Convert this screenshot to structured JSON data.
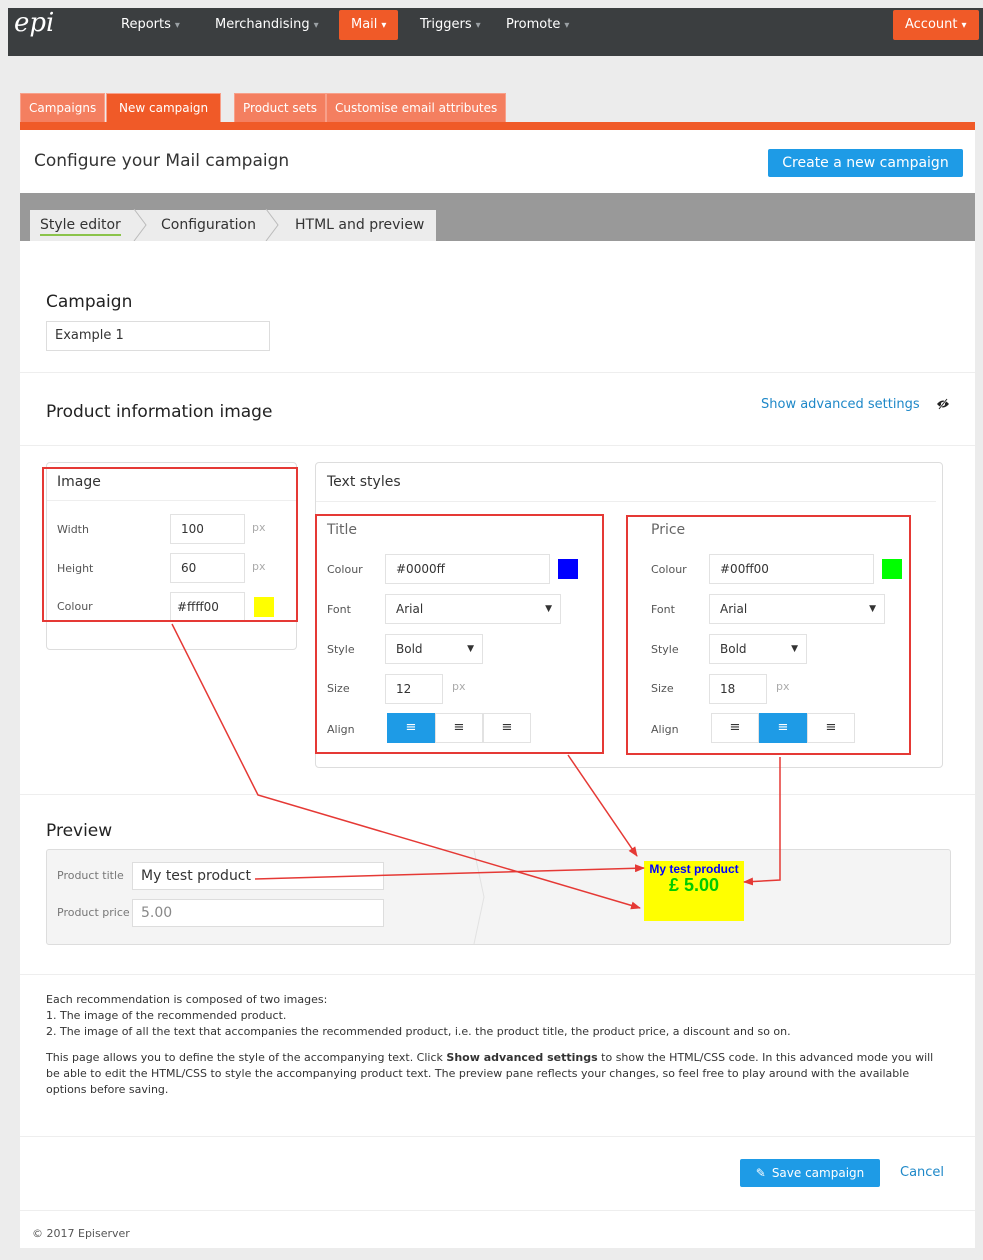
{
  "nav": {
    "logo": "epi",
    "items": [
      {
        "label": "Reports"
      },
      {
        "label": "Merchandising"
      },
      {
        "label": "Mail"
      },
      {
        "label": "Triggers"
      },
      {
        "label": "Promote"
      }
    ],
    "active": "Mail",
    "account": "Account"
  },
  "tabs": [
    {
      "label": "Campaigns"
    },
    {
      "label": "New campaign"
    },
    {
      "label": "Product sets"
    },
    {
      "label": "Customise email attributes"
    }
  ],
  "page": {
    "title": "Configure your Mail campaign",
    "create_button": "Create a new campaign"
  },
  "steps": [
    "Style editor",
    "Configuration",
    "HTML and preview"
  ],
  "campaign": {
    "heading": "Campaign",
    "name_value": "Example 1"
  },
  "product_info": {
    "heading": "Product information image",
    "advanced_link": "Show advanced settings",
    "advanced_icon": "eye-slash-icon"
  },
  "image_panel": {
    "heading": "Image",
    "width_label": "Width",
    "width_value": "100",
    "height_label": "Height",
    "height_value": "60",
    "colour_label": "Colour",
    "colour_value": "#ffff00",
    "unit": "px",
    "swatch_color": "#ffff00"
  },
  "text_styles": {
    "heading": "Text styles",
    "title": {
      "heading": "Title",
      "colour_label": "Colour",
      "colour_value": "#0000ff",
      "swatch_color": "#0000ff",
      "font_label": "Font",
      "font_value": "Arial",
      "style_label": "Style",
      "style_value": "Bold",
      "size_label": "Size",
      "size_value": "12",
      "unit": "px",
      "align_label": "Align",
      "align_selected": "left"
    },
    "price": {
      "heading": "Price",
      "colour_label": "Colour",
      "colour_value": "#00ff00",
      "swatch_color": "#00ff00",
      "font_label": "Font",
      "font_value": "Arial",
      "style_label": "Style",
      "style_value": "Bold",
      "size_label": "Size",
      "size_value": "18",
      "unit": "px",
      "align_label": "Align",
      "align_selected": "center"
    }
  },
  "preview": {
    "heading": "Preview",
    "title_label": "Product title",
    "title_value": "My test product",
    "price_label": "Product price",
    "price_value": "5.00",
    "image_title": "My test product",
    "image_price": "£ 5.00"
  },
  "info": {
    "line1": "Each recommendation is composed of two images:",
    "line2": "1. The image of the recommended product.",
    "line3": "2. The image of all the text that accompanies the recommended product, i.e. the product title, the product price, a discount and so on.",
    "para_pre": "This page allows you to define the style of the accompanying text. Click ",
    "para_bold": "Show advanced settings",
    "para_post": " to show the HTML/CSS code. In this advanced mode you will be able to edit the HTML/CSS to style the accompanying product text. The preview pane reflects your changes, so feel free to play around with the available options before saving."
  },
  "footer": {
    "save": "Save campaign",
    "cancel": "Cancel",
    "copyright": "© 2017 Episerver"
  },
  "colors": {
    "brand_orange": "#f05a28",
    "accent_blue": "#1e9be6",
    "annotation_red": "#e53935"
  }
}
